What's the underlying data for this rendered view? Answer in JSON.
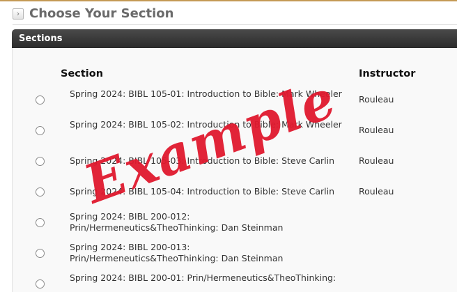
{
  "page": {
    "title": "Choose Your Section"
  },
  "panel": {
    "title": "Sections"
  },
  "table": {
    "headers": {
      "section": "Section",
      "instructor": "Instructor"
    },
    "rows": [
      {
        "section": "Spring 2024: BIBL 105-01: Introduction to Bible: Mark Wheeler",
        "instructor": "Rouleau"
      },
      {
        "section": "Spring 2024: BIBL 105-02: Introduction to Bible: Mark Wheeler",
        "instructor": "Rouleau"
      },
      {
        "section": "Spring 2024: BIBL 105-03: Introduction to Bible: Steve Carlin",
        "instructor": "Rouleau"
      },
      {
        "section": "Spring 2024: BIBL 105-04: Introduction to Bible: Steve Carlin",
        "instructor": "Rouleau"
      },
      {
        "section": "Spring 2024: BIBL 200-012: Prin/Hermeneutics&TheoThinking: Dan Steinman",
        "instructor": ""
      },
      {
        "section": "Spring 2024: BIBL 200-013: Prin/Hermeneutics&TheoThinking: Dan Steinman",
        "instructor": ""
      },
      {
        "section": "Spring 2024: BIBL 200-01: Prin/Hermeneutics&TheoThinking:",
        "instructor": ""
      }
    ]
  },
  "watermark": {
    "text": "Example"
  },
  "colors": {
    "accent_rule": "#c49a55",
    "panel_header": "#2b2b2b",
    "watermark": "#e0192e"
  }
}
